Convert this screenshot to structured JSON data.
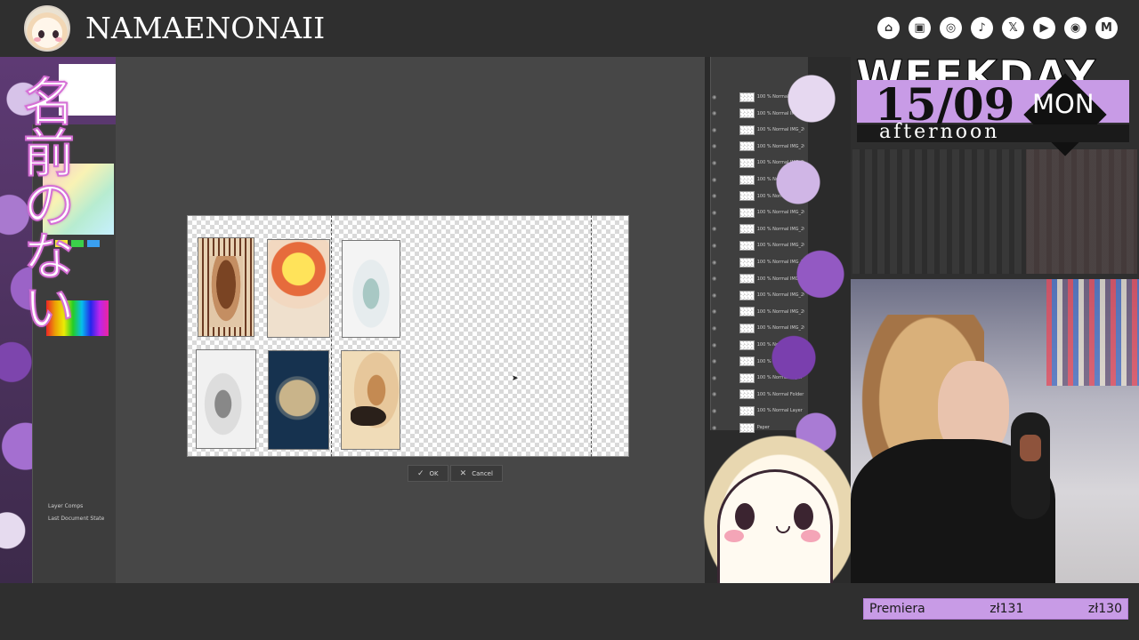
{
  "header": {
    "brand": "NAMAENONAII",
    "socials": [
      {
        "icon": "streamlabs-icon",
        "glyph": "⌂"
      },
      {
        "icon": "twitch-icon",
        "glyph": "▣"
      },
      {
        "icon": "instagram-icon",
        "glyph": "◎"
      },
      {
        "icon": "tiktok-icon",
        "glyph": "♪"
      },
      {
        "icon": "x-icon",
        "glyph": "𝕏"
      },
      {
        "icon": "youtube-icon",
        "glyph": "▶"
      },
      {
        "icon": "discord-icon",
        "glyph": "◉"
      },
      {
        "icon": "gmail-icon",
        "glyph": "M"
      }
    ]
  },
  "overlay": {
    "vertical_title": "名前のない"
  },
  "left_panel": {
    "layer_comps_label": "Layer Comps",
    "last_document_state": "Last Document State"
  },
  "dialog": {
    "ok_label": "OK",
    "cancel_label": "Cancel"
  },
  "layers": [
    "100 % Normal IMG_2025...",
    "100 % Normal IMG_2024101...",
    "100 % Normal IMG_2025...",
    "100 % Normal IMG_2024...",
    "100 % Normal IMG_2024...",
    "100 % Normal",
    "100 % Normal",
    "100 % Normal IMG_2024...",
    "100 % Normal IMG_20250106_1...",
    "100 % Normal IMG_20250105_1...",
    "100 % Normal IMG_20241027_1...",
    "100 % Normal IMG_20241027_1...",
    "100 % Normal IMG_20241027_1...",
    "100 % Normal IMG_20241023_1...",
    "100 % Normal IMG_20241016_1...",
    "100 % Normal Layer 13",
    "100 % Normal Layer 12",
    "100 % Normal Layer 7",
    "100 % Normal Folder 1",
    "100 % Normal Layer 1",
    "Paper"
  ],
  "schedule": {
    "weekday": "WEEKDAY",
    "date": "15/09",
    "day": "MON",
    "time_of_day": "afternoon"
  },
  "ticker": {
    "label": "Premiera",
    "price_a": "zł131",
    "price_b": "zł130"
  },
  "colors": {
    "accent_lilac": "#c89be6",
    "background": "#2f2f2f"
  }
}
